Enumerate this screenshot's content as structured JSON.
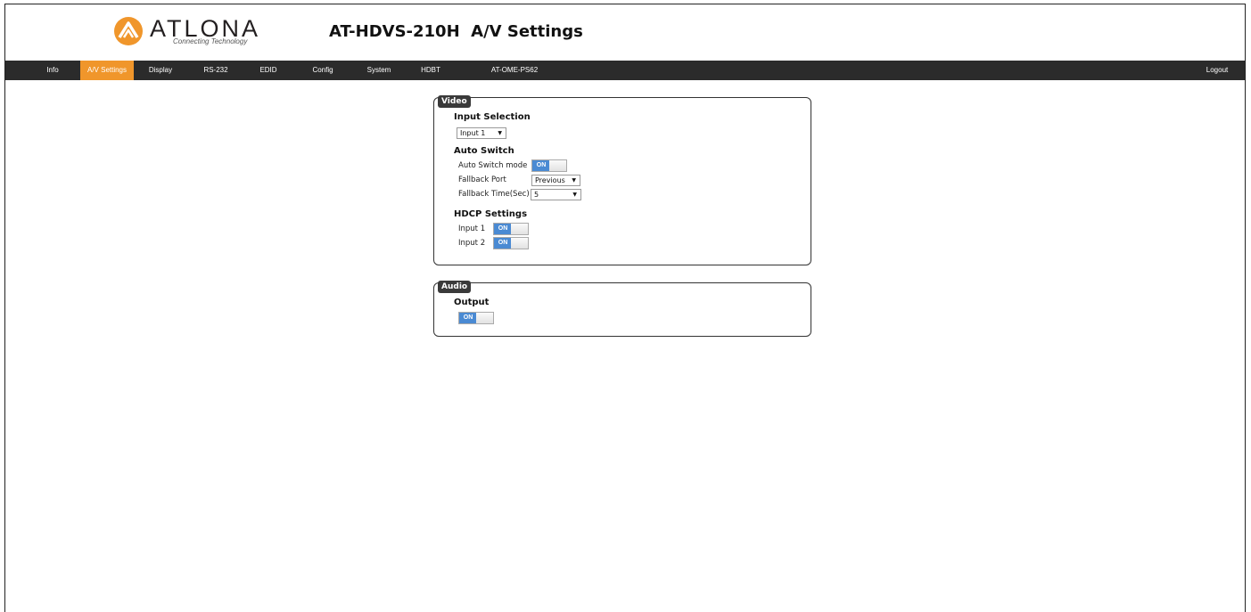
{
  "brand": {
    "name": "ATLONA",
    "tagline": "Connecting Technology",
    "accent": "#f0962b"
  },
  "page_title": "AT-HDVS-210H  A/V Settings",
  "nav": {
    "items": [
      "Info",
      "A/V Settings",
      "Display",
      "RS-232",
      "EDID",
      "Config",
      "System",
      "HDBT",
      "AT-OME-PS62"
    ],
    "active": "A/V Settings",
    "logout": "Logout"
  },
  "video": {
    "legend": "Video",
    "input_selection": {
      "title": "Input Selection",
      "value": "Input 1"
    },
    "auto_switch": {
      "title": "Auto Switch",
      "mode_label": "Auto Switch mode",
      "mode_state": "ON",
      "fallback_port_label": "Fallback Port",
      "fallback_port_value": "Previous",
      "fallback_time_label": "Fallback Time(Sec)",
      "fallback_time_value": "5"
    },
    "hdcp": {
      "title": "HDCP Settings",
      "input1_label": "Input 1",
      "input1_state": "ON",
      "input2_label": "Input 2",
      "input2_state": "ON"
    }
  },
  "audio": {
    "legend": "Audio",
    "output_title": "Output",
    "output_state": "ON"
  }
}
